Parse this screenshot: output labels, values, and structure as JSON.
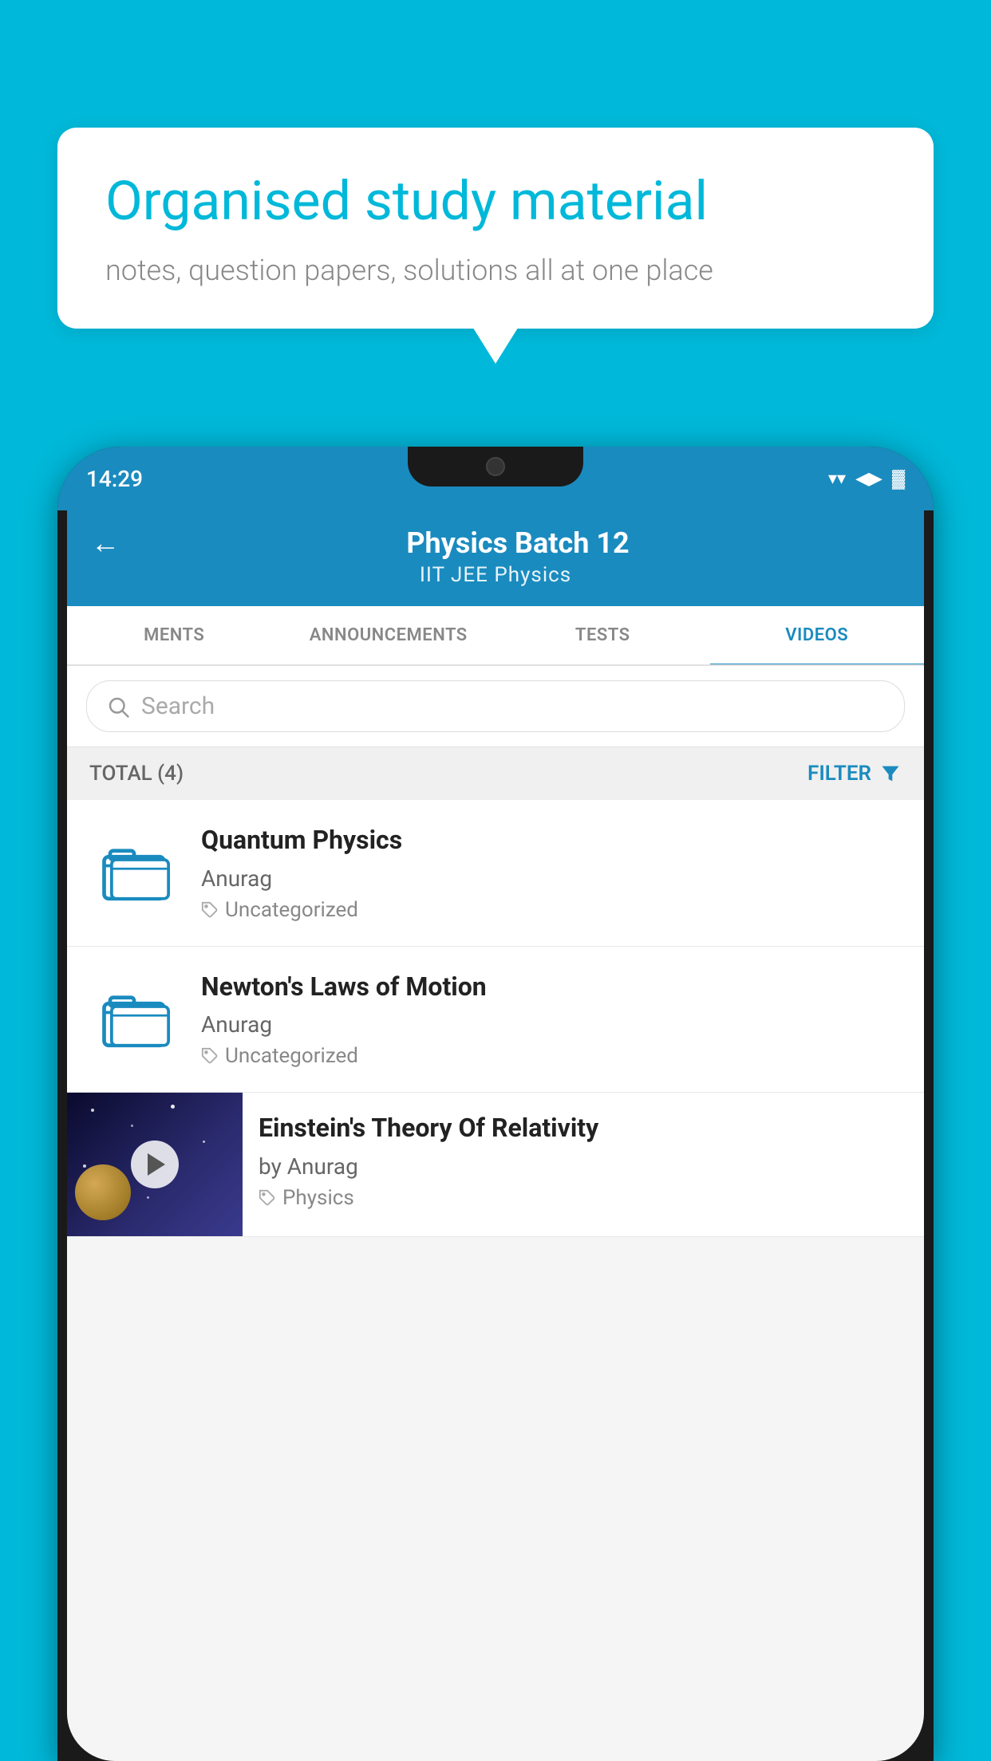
{
  "background": {
    "color": "#00b8d9"
  },
  "speech_bubble": {
    "title": "Organised study material",
    "subtitle": "notes, question papers, solutions all at one place"
  },
  "status_bar": {
    "time": "14:29",
    "wifi": "▼",
    "signal": "▲",
    "battery": "▐"
  },
  "header": {
    "title": "Physics Batch 12",
    "subtitle": "IIT JEE   Physics",
    "back_label": "←"
  },
  "tabs": [
    {
      "label": "MENTS",
      "active": false
    },
    {
      "label": "ANNOUNCEMENTS",
      "active": false
    },
    {
      "label": "TESTS",
      "active": false
    },
    {
      "label": "VIDEOS",
      "active": true
    }
  ],
  "search": {
    "placeholder": "Search"
  },
  "filter_bar": {
    "total_label": "TOTAL (4)",
    "filter_label": "FILTER"
  },
  "videos": [
    {
      "title": "Quantum Physics",
      "author": "Anurag",
      "tag": "Uncategorized",
      "has_thumbnail": false
    },
    {
      "title": "Newton's Laws of Motion",
      "author": "Anurag",
      "tag": "Uncategorized",
      "has_thumbnail": false
    },
    {
      "title": "Einstein's Theory Of Relativity",
      "author": "by Anurag",
      "tag": "Physics",
      "has_thumbnail": true
    }
  ]
}
